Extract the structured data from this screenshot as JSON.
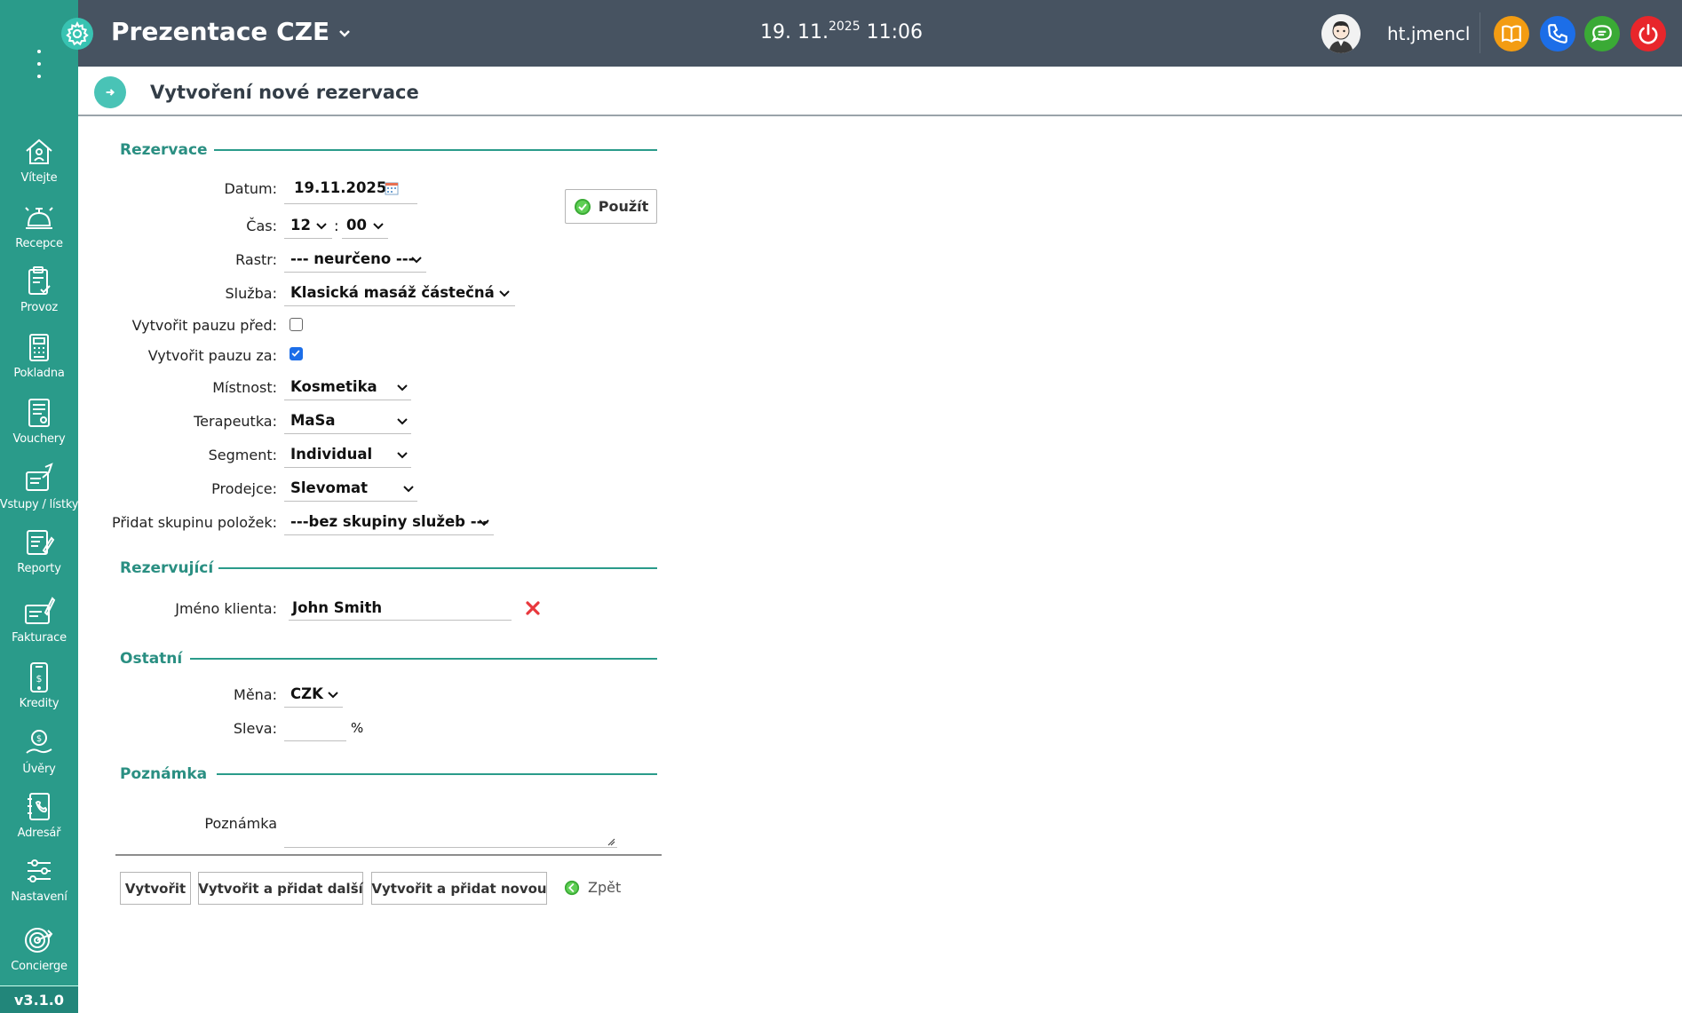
{
  "app": {
    "title": "Prezentace CZE",
    "date": "19. 11.",
    "year": "2025",
    "time": "11:06",
    "username": "ht.jmencl",
    "version": "v3.1.0"
  },
  "sidebar": {
    "items": [
      {
        "label": "Vítejte",
        "icon": "home-icon"
      },
      {
        "label": "Recepce",
        "icon": "reception-bell-icon"
      },
      {
        "label": "Provoz",
        "icon": "clipboard-check-icon"
      },
      {
        "label": "Pokladna",
        "icon": "cash-register-icon"
      },
      {
        "label": "Vouchery",
        "icon": "voucher-icon"
      },
      {
        "label": "Vstupy / lístky",
        "icon": "tickets-icon"
      },
      {
        "label": "Reporty",
        "icon": "report-icon"
      },
      {
        "label": "Fakturace",
        "icon": "invoice-icon"
      },
      {
        "label": "Kredity",
        "icon": "credit-phone-icon"
      },
      {
        "label": "Úvěry",
        "icon": "loan-hand-icon"
      },
      {
        "label": "Adresář",
        "icon": "address-book-icon"
      },
      {
        "label": "Nastavení",
        "icon": "sliders-icon"
      },
      {
        "label": "Concierge",
        "icon": "concierge-target-icon"
      }
    ]
  },
  "page": {
    "title": "Vytvoření nové rezervace"
  },
  "form": {
    "sections": {
      "reservation": "Rezervace",
      "booker": "Rezervující",
      "other": "Ostatní",
      "note": "Poznámka"
    },
    "labels": {
      "date": "Datum:",
      "time": "Čas:",
      "grid": "Rastr:",
      "service": "Služba:",
      "pause_before": "Vytvořit pauzu před:",
      "pause_after": "Vytvořit pauzu za:",
      "room": "Místnost:",
      "therapist": "Terapeutka:",
      "segment": "Segment:",
      "seller": "Prodejce:",
      "add_group": "Přidat skupinu položek:",
      "client_name": "Jméno klienta:",
      "currency": "Měna:",
      "discount": "Sleva:",
      "note": "Poznámka"
    },
    "values": {
      "date": "19.11.2025",
      "hour": "12",
      "time_separator": ":",
      "minute": "00",
      "grid": "--- neurčeno ---",
      "service": "Klasická masáž částečná",
      "pause_before": false,
      "pause_after": true,
      "room": "Kosmetika",
      "therapist": "MaSa",
      "segment": "Individual",
      "seller": "Slevomat",
      "add_group": "---bez skupiny služeb ---",
      "client_name": "John Smith",
      "currency": "CZK",
      "discount": "",
      "discount_unit": "%",
      "note": ""
    },
    "apply_button": "Použít"
  },
  "actions": {
    "create": "Vytvořit",
    "create_add_another": "Vytvořit a přidat další",
    "create_add_new": "Vytvořit a přidat novou",
    "back": "Zpět"
  },
  "colors": {
    "sidebar": "#2a9b8a",
    "header": "#475361",
    "accent": "#2a8f82",
    "book": "#f39c12",
    "phone": "#1c6ee8",
    "chat": "#3aaa35",
    "power": "#e8262b"
  }
}
